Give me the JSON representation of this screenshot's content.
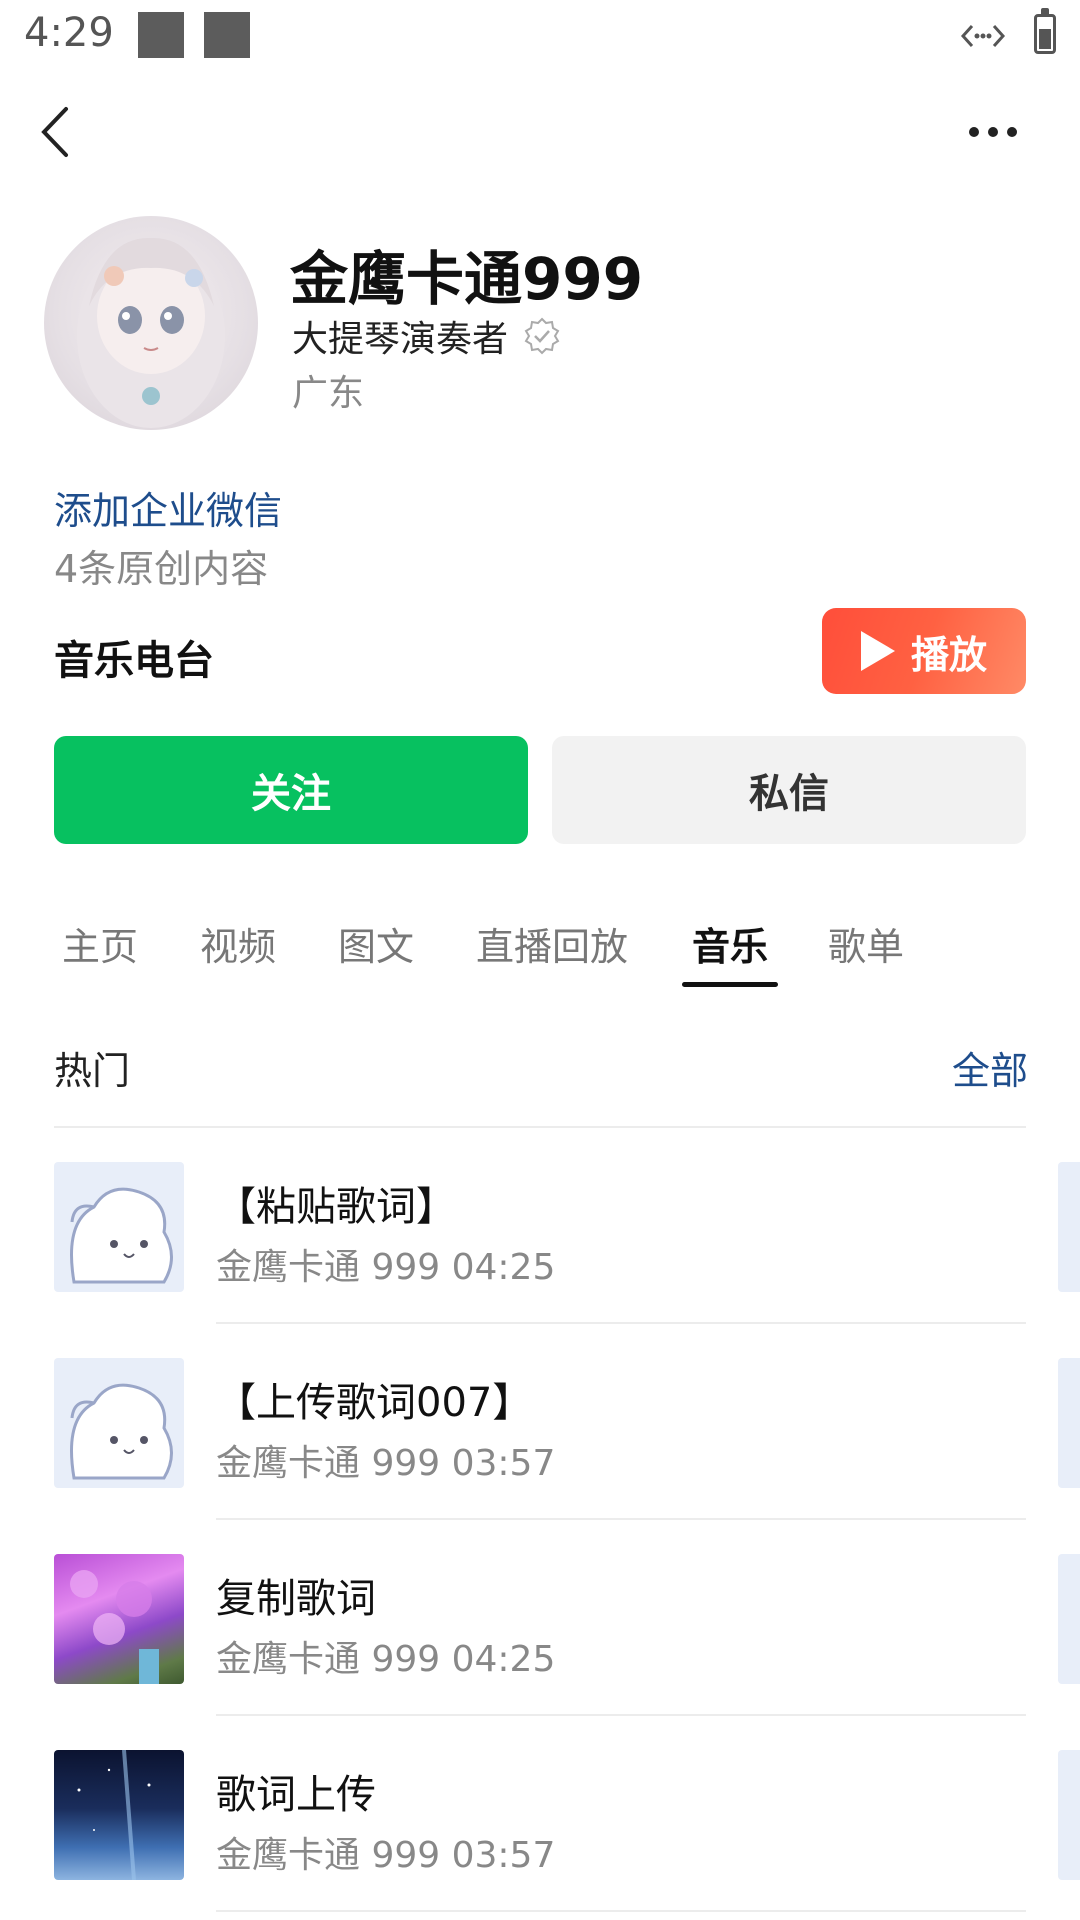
{
  "status_bar": {
    "time": "4:29"
  },
  "profile": {
    "name": "金鹰卡通999",
    "title": "大提琴演奏者",
    "region": "广东",
    "wechat_link": "添加企业微信",
    "original_count": "4条原创内容"
  },
  "radio": {
    "label": "音乐电台",
    "play_label": "播放"
  },
  "actions": {
    "follow_label": "关注",
    "message_label": "私信"
  },
  "tabs": [
    {
      "label": "主页"
    },
    {
      "label": "视频"
    },
    {
      "label": "图文"
    },
    {
      "label": "直播回放"
    },
    {
      "label": "音乐",
      "active": true
    },
    {
      "label": "歌单"
    }
  ],
  "section": {
    "hot_label": "热门",
    "all_label": "全部"
  },
  "songs": [
    {
      "title": "【粘贴歌词】",
      "subtitle": "金鹰卡通 999 04:25",
      "thumb": "cartoon"
    },
    {
      "title": "【上传歌词007】",
      "subtitle": "金鹰卡通 999 03:57",
      "thumb": "cartoon"
    },
    {
      "title": "复制歌词",
      "subtitle": "金鹰卡通 999 04:25",
      "thumb": "flower"
    },
    {
      "title": "歌词上传",
      "subtitle": "金鹰卡通 999 03:57",
      "thumb": "sky"
    }
  ],
  "colors": {
    "accent_green": "#07c160",
    "link_blue": "#1e4d8c",
    "play_red": "#ff4e3a"
  }
}
